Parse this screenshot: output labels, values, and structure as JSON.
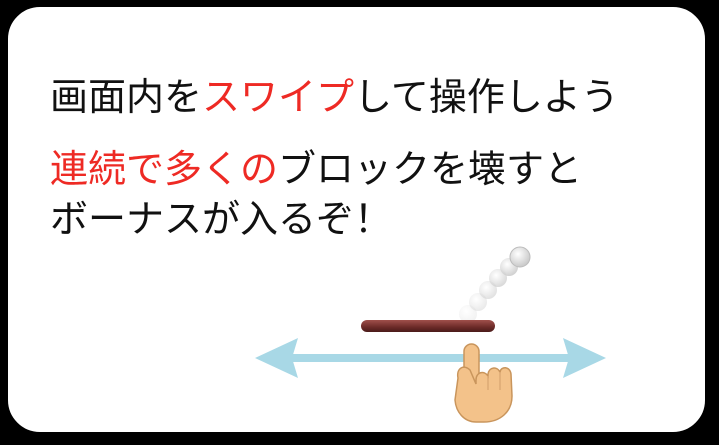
{
  "instructions": {
    "line1": {
      "before": "画面内を",
      "highlight": "スワイプ",
      "after": "して操作しよう"
    },
    "line2": {
      "highlight": "連続で多くの",
      "after": "ブロックを壊すと"
    },
    "line3": {
      "text": "ボーナスが入るぞ！"
    }
  },
  "colors": {
    "background": "#ffffff",
    "border": "#000000",
    "text": "#111111",
    "highlight": "#ee2a24",
    "arrow": "#a8d8e6",
    "paddle": "#6b2a28",
    "hand": "#f3c28a"
  },
  "icons": {
    "paddle": "paddle-icon",
    "ball_trail": "ball-trail-icon",
    "swipe_arrow": "double-arrow-icon",
    "hand": "pointing-hand-icon"
  }
}
